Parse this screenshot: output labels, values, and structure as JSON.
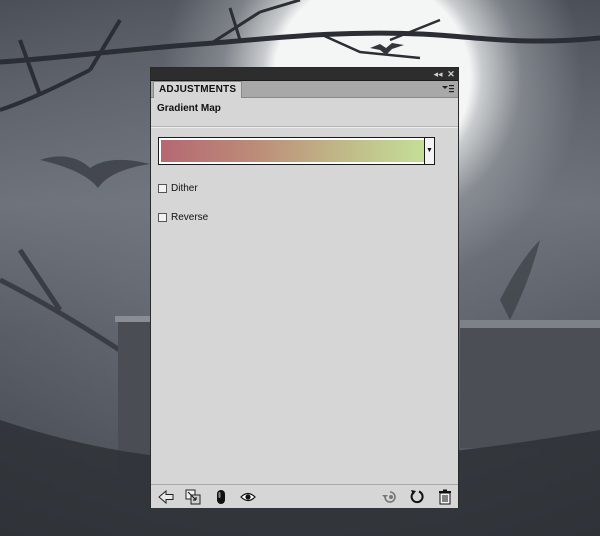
{
  "panel": {
    "tab_label": "ADJUSTMENTS",
    "title": "Gradient Map",
    "titlebar_icons": [
      "collapse-icon",
      "close-icon"
    ],
    "menu_icon": "panel-menu-icon"
  },
  "gradient": {
    "colors": [
      "#b56872",
      "#bc8a78",
      "#c0b888",
      "#c4e298"
    ]
  },
  "options": [
    {
      "label": "Dither",
      "checked": false
    },
    {
      "label": "Reverse",
      "checked": false
    }
  ],
  "bottom_icons": {
    "left": [
      "back-arrow-icon",
      "clip-to-layer-icon",
      "layer-mask-icon",
      "visibility-eye-icon"
    ],
    "right": [
      "view-previous-state-icon",
      "reset-icon",
      "trash-icon"
    ]
  }
}
